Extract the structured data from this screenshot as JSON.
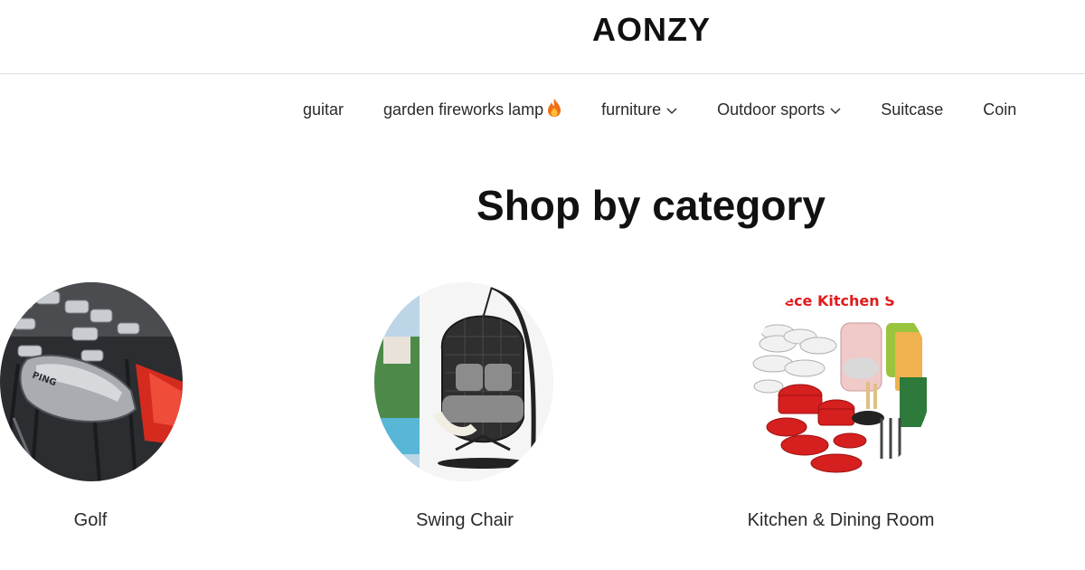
{
  "header": {
    "logo": "AONZY"
  },
  "nav": {
    "items": [
      {
        "label": "guitar",
        "has_dropdown": false
      },
      {
        "label": "garden fireworks lamp",
        "icon": "fire-icon",
        "has_dropdown": false
      },
      {
        "label": "furniture",
        "has_dropdown": true
      },
      {
        "label": "Outdoor sports",
        "has_dropdown": true
      },
      {
        "label": "Suitcase",
        "has_dropdown": false
      },
      {
        "label": "Coin",
        "has_dropdown": false
      }
    ]
  },
  "main": {
    "section_title": "Shop by category",
    "categories": [
      {
        "label": "Golf",
        "image": "golf-clubs-photo"
      },
      {
        "label": "Swing Chair",
        "image": "swing-chair-photo"
      },
      {
        "label": "Kitchen & Dining Room",
        "image": "kitchen-set-photo",
        "image_text": "Piece Kitchen S"
      }
    ]
  },
  "colors": {
    "text": "#222222",
    "divider": "#dedede",
    "background": "#ffffff",
    "flame": "#f0701a"
  }
}
